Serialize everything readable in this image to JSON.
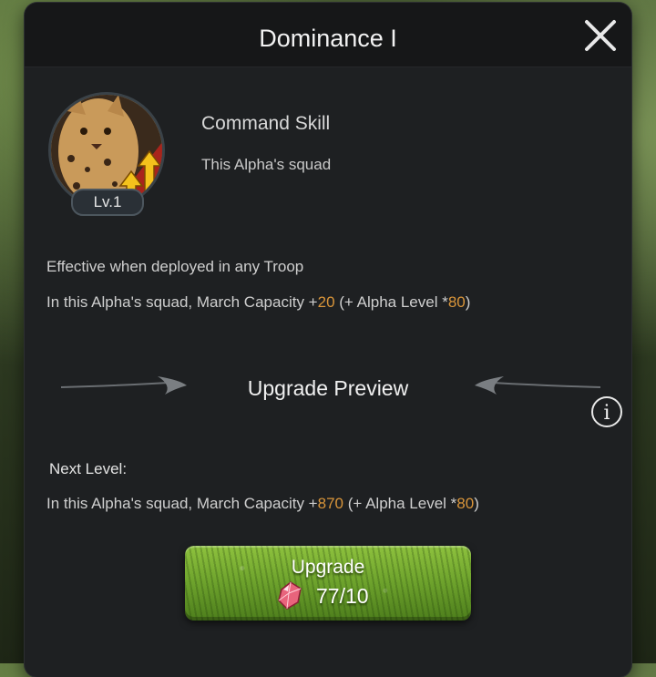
{
  "dialog": {
    "title": "Dominance I"
  },
  "skill": {
    "name": "Command Skill",
    "scope": "This Alpha's squad",
    "level": "Lv.1",
    "effective": "Effective when deployed in any Troop",
    "current": {
      "prefix": "In this Alpha's squad, March Capacity +",
      "value": "20",
      "middle": " (+ Alpha Level *",
      "multiplier": "80",
      "suffix": ")"
    }
  },
  "preview": {
    "title": "Upgrade Preview",
    "next_label": "Next Level:",
    "next": {
      "prefix": "In this Alpha's squad, March Capacity +",
      "value": "870",
      "middle": " (+ Alpha Level *",
      "multiplier": "80",
      "suffix": ")"
    }
  },
  "upgrade": {
    "label": "Upgrade",
    "cost": "77/10"
  },
  "colors": {
    "highlight": "#d9953a",
    "panel": "#1e2022",
    "button_green": "#6da22c"
  },
  "icons": {
    "close": "close-icon",
    "info": "info-icon",
    "gem": "gem-icon",
    "skill": "upgrade-arrows-icon"
  }
}
